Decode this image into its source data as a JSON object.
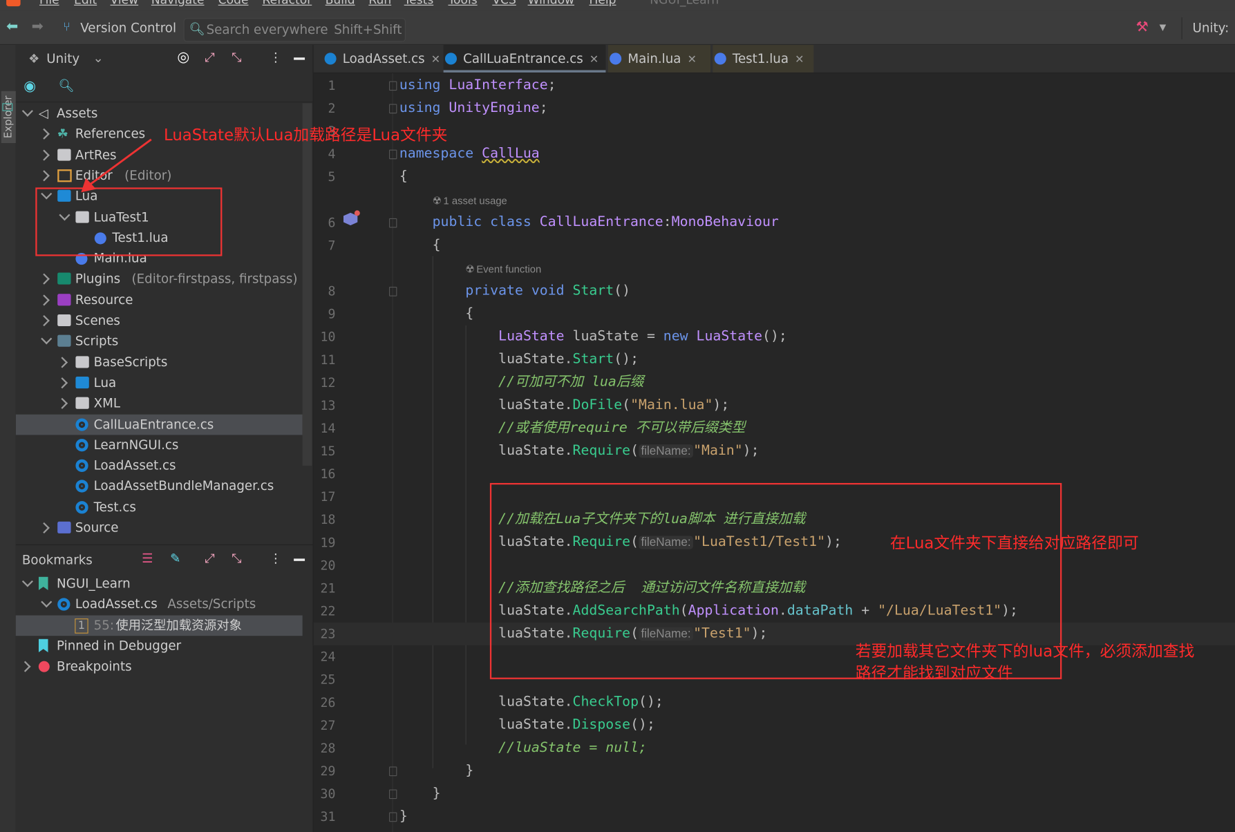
{
  "menu": [
    "File",
    "Edit",
    "View",
    "Navigate",
    "Code",
    "Refactor",
    "Build",
    "Run",
    "Tests",
    "Tools",
    "VCS",
    "Window",
    "Help"
  ],
  "project_title": "NGUI_Learn",
  "toolbar": {
    "vcs": "Version Control",
    "search_placeholder": "Search everywhere",
    "search_shortcut": "Shift+Shift",
    "unity": "Unity:"
  },
  "side_strip": {
    "label": "Explorer"
  },
  "explorer": {
    "title": "Unity",
    "tree": [
      {
        "label": "Assets",
        "level": 0,
        "chev": "down",
        "icon": "unity-icon"
      },
      {
        "label": "References",
        "level": 1,
        "chev": "right",
        "icon": "references-icon"
      },
      {
        "label": "ArtRes",
        "level": 1,
        "chev": "right",
        "icon": "folder-icon"
      },
      {
        "label": "Editor",
        "suffix": "(Editor)",
        "level": 1,
        "chev": "right",
        "icon": "editor-folder-icon"
      },
      {
        "label": "Lua",
        "level": 1,
        "chev": "down",
        "icon": "lua-folder-icon"
      },
      {
        "label": "LuaTest1",
        "level": 2,
        "chev": "down",
        "icon": "folder-icon"
      },
      {
        "label": "Test1.lua",
        "level": 3,
        "chev": "none",
        "icon": "lua-file-icon"
      },
      {
        "label": "Main.lua",
        "level": 2,
        "chev": "none",
        "icon": "lua-file-icon"
      },
      {
        "label": "Plugins",
        "suffix": "(Editor-firstpass, firstpass)",
        "level": 1,
        "chev": "right",
        "icon": "plugins-folder-icon"
      },
      {
        "label": "Resource",
        "level": 1,
        "chev": "right",
        "icon": "resource-folder-icon"
      },
      {
        "label": "Scenes",
        "level": 1,
        "chev": "right",
        "icon": "folder-icon"
      },
      {
        "label": "Scripts",
        "level": 1,
        "chev": "down",
        "icon": "scripts-folder-icon"
      },
      {
        "label": "BaseScripts",
        "level": 2,
        "chev": "right",
        "icon": "folder-icon"
      },
      {
        "label": "Lua",
        "level": 2,
        "chev": "right",
        "icon": "lua-folder-icon"
      },
      {
        "label": "XML",
        "level": 2,
        "chev": "right",
        "icon": "folder-icon"
      },
      {
        "label": "CallLuaEntrance.cs",
        "level": 2,
        "chev": "none",
        "icon": "csharp-file-icon",
        "selected": true
      },
      {
        "label": "LearnNGUI.cs",
        "level": 2,
        "chev": "none",
        "icon": "csharp-file-icon"
      },
      {
        "label": "LoadAsset.cs",
        "level": 2,
        "chev": "none",
        "icon": "csharp-file-icon"
      },
      {
        "label": "LoadAssetBundleManager.cs",
        "level": 2,
        "chev": "none",
        "icon": "csharp-file-icon"
      },
      {
        "label": "Test.cs",
        "level": 2,
        "chev": "none",
        "icon": "csharp-file-icon"
      },
      {
        "label": "Source",
        "level": 1,
        "chev": "right",
        "icon": "source-folder-icon"
      }
    ]
  },
  "bookmarks": {
    "title": "Bookmarks",
    "items": [
      {
        "label": "NGUI_Learn",
        "level": 0,
        "chev": "down",
        "icon": "bookmark-icon"
      },
      {
        "label": "LoadAsset.cs",
        "suffix": "Assets/Scripts",
        "level": 1,
        "chev": "down",
        "icon": "csharp-file-icon"
      },
      {
        "badge": "1",
        "line": "55:",
        "label": "使用泛型加载资源对象",
        "level": 2,
        "chev": "none",
        "selected": true
      },
      {
        "label": "Pinned in Debugger",
        "level": 0,
        "chev": "none",
        "icon": "pinned-bookmark-icon"
      },
      {
        "label": "Breakpoints",
        "level": 0,
        "chev": "right",
        "icon": "breakpoint-icon"
      }
    ]
  },
  "tabs": [
    {
      "label": "LoadAsset.cs",
      "type": "cs"
    },
    {
      "label": "CallLuaEntrance.cs",
      "type": "cs",
      "active": true
    },
    {
      "label": "Main.lua",
      "type": "lua"
    },
    {
      "label": "Test1.lua",
      "type": "lua"
    }
  ],
  "code": [
    {
      "n": "1",
      "i": 0,
      "s": [
        [
          "kw",
          "using "
        ],
        [
          "ty",
          "LuaInterface"
        ],
        [
          "pl",
          ";"
        ]
      ]
    },
    {
      "n": "2",
      "i": 0,
      "s": [
        [
          "kw",
          "using "
        ],
        [
          "ty",
          "UnityEngine"
        ],
        [
          "pl",
          ";"
        ]
      ]
    },
    {
      "n": "3",
      "i": 0,
      "s": []
    },
    {
      "n": "4",
      "i": 0,
      "s": [
        [
          "kw",
          "namespace "
        ],
        [
          "ty squig",
          "CallLua"
        ]
      ]
    },
    {
      "n": "5",
      "i": 0,
      "s": [
        [
          "pl",
          "{"
        ]
      ]
    },
    {
      "hint": "1 asset usage",
      "i": 4
    },
    {
      "n": "6",
      "i": 4,
      "s": [
        [
          "kw",
          "public class "
        ],
        [
          "ty",
          "CallLuaEntrance"
        ],
        [
          "pl",
          ":"
        ],
        [
          "ty",
          "MonoBehaviour"
        ]
      ]
    },
    {
      "n": "7",
      "i": 4,
      "s": [
        [
          "pl",
          "{"
        ]
      ]
    },
    {
      "hint": "Event function",
      "i": 8
    },
    {
      "n": "8",
      "i": 8,
      "s": [
        [
          "kw",
          "private void "
        ],
        [
          "me",
          "Start"
        ],
        [
          "pl",
          "()"
        ]
      ]
    },
    {
      "n": "9",
      "i": 8,
      "s": [
        [
          "pl",
          "{"
        ]
      ]
    },
    {
      "n": "10",
      "i": 12,
      "s": [
        [
          "ty",
          "LuaState"
        ],
        [
          "pl",
          " luaState = "
        ],
        [
          "kw",
          "new "
        ],
        [
          "ty",
          "LuaState"
        ],
        [
          "pl",
          "();"
        ]
      ]
    },
    {
      "n": "11",
      "i": 12,
      "s": [
        [
          "pl",
          "luaState."
        ],
        [
          "me",
          "Start"
        ],
        [
          "pl",
          "();"
        ]
      ]
    },
    {
      "n": "12",
      "i": 12,
      "s": [
        [
          "cm",
          "//可加可不加 lua后缀"
        ]
      ]
    },
    {
      "n": "13",
      "i": 12,
      "s": [
        [
          "pl",
          "luaState."
        ],
        [
          "me",
          "DoFile"
        ],
        [
          "pl",
          "("
        ],
        [
          "st",
          "\"Main.lua\""
        ],
        [
          "pl",
          ");"
        ]
      ]
    },
    {
      "n": "14",
      "i": 12,
      "s": [
        [
          "cm",
          "//或者使用require 不可以带后缀类型"
        ]
      ]
    },
    {
      "n": "15",
      "i": 12,
      "s": [
        [
          "pl",
          "luaState."
        ],
        [
          "me",
          "Require"
        ],
        [
          "pl",
          "("
        ],
        [
          "hint",
          "fileName:"
        ],
        [
          "st",
          "\"Main\""
        ],
        [
          "pl",
          ");"
        ]
      ]
    },
    {
      "n": "16",
      "i": 12,
      "s": []
    },
    {
      "n": "17",
      "i": 12,
      "s": []
    },
    {
      "n": "18",
      "i": 12,
      "s": [
        [
          "cm",
          "//加载在Lua子文件夹下的lua脚本 进行直接加载"
        ]
      ]
    },
    {
      "n": "19",
      "i": 12,
      "s": [
        [
          "pl",
          "luaState."
        ],
        [
          "me",
          "Require"
        ],
        [
          "pl",
          "("
        ],
        [
          "hint",
          "fileName:"
        ],
        [
          "st",
          "\"LuaTest1/Test1\""
        ],
        [
          "pl",
          ");"
        ]
      ]
    },
    {
      "n": "20",
      "i": 12,
      "s": []
    },
    {
      "n": "21",
      "i": 12,
      "s": [
        [
          "cm",
          "//添加查找路径之后  通过访问文件名称直接加载"
        ]
      ]
    },
    {
      "n": "22",
      "i": 12,
      "s": [
        [
          "pl",
          "luaState."
        ],
        [
          "me",
          "AddSearchPath"
        ],
        [
          "pl",
          "("
        ],
        [
          "ty",
          "Application"
        ],
        [
          "pl",
          "."
        ],
        [
          "fi",
          "dataPath"
        ],
        [
          "pl",
          " + "
        ],
        [
          "st",
          "\"/Lua/LuaTest1\""
        ],
        [
          "pl",
          ");"
        ]
      ]
    },
    {
      "n": "23",
      "i": 12,
      "s": [
        [
          "pl",
          "luaState."
        ],
        [
          "me",
          "Require"
        ],
        [
          "pl",
          "("
        ],
        [
          "hint",
          "fileName:"
        ],
        [
          "st",
          "\"Test1\""
        ],
        [
          "pl",
          ");"
        ]
      ],
      "current": true
    },
    {
      "n": "24",
      "i": 12,
      "s": []
    },
    {
      "n": "25",
      "i": 12,
      "s": []
    },
    {
      "n": "26",
      "i": 12,
      "s": [
        [
          "pl",
          "luaState."
        ],
        [
          "me",
          "CheckTop"
        ],
        [
          "pl",
          "();"
        ]
      ]
    },
    {
      "n": "27",
      "i": 12,
      "s": [
        [
          "pl",
          "luaState."
        ],
        [
          "me",
          "Dispose"
        ],
        [
          "pl",
          "();"
        ]
      ]
    },
    {
      "n": "28",
      "i": 12,
      "s": [
        [
          "cm",
          "//luaState = null;"
        ]
      ]
    },
    {
      "n": "29",
      "i": 8,
      "s": [
        [
          "pl",
          "}"
        ]
      ]
    },
    {
      "n": "30",
      "i": 4,
      "s": [
        [
          "pl",
          "}"
        ]
      ]
    },
    {
      "n": "31",
      "i": 0,
      "s": [
        [
          "pl",
          "}"
        ]
      ]
    }
  ],
  "annotations": {
    "a1": "LuaState默认Lua加载路径是Lua文件夹",
    "a2": "在Lua文件夹下直接给对应路径即可",
    "a3_line1": "若要加载其它文件夹下的lua文件，必须添加查找",
    "a3_line2": "路径才能找到对应文件"
  },
  "colors": {
    "accent_red": "#ee3333",
    "keyword": "#6c95eb",
    "type": "#c191ff",
    "method": "#39cc8f",
    "string": "#c9a26d",
    "comment": "#85c46c"
  }
}
